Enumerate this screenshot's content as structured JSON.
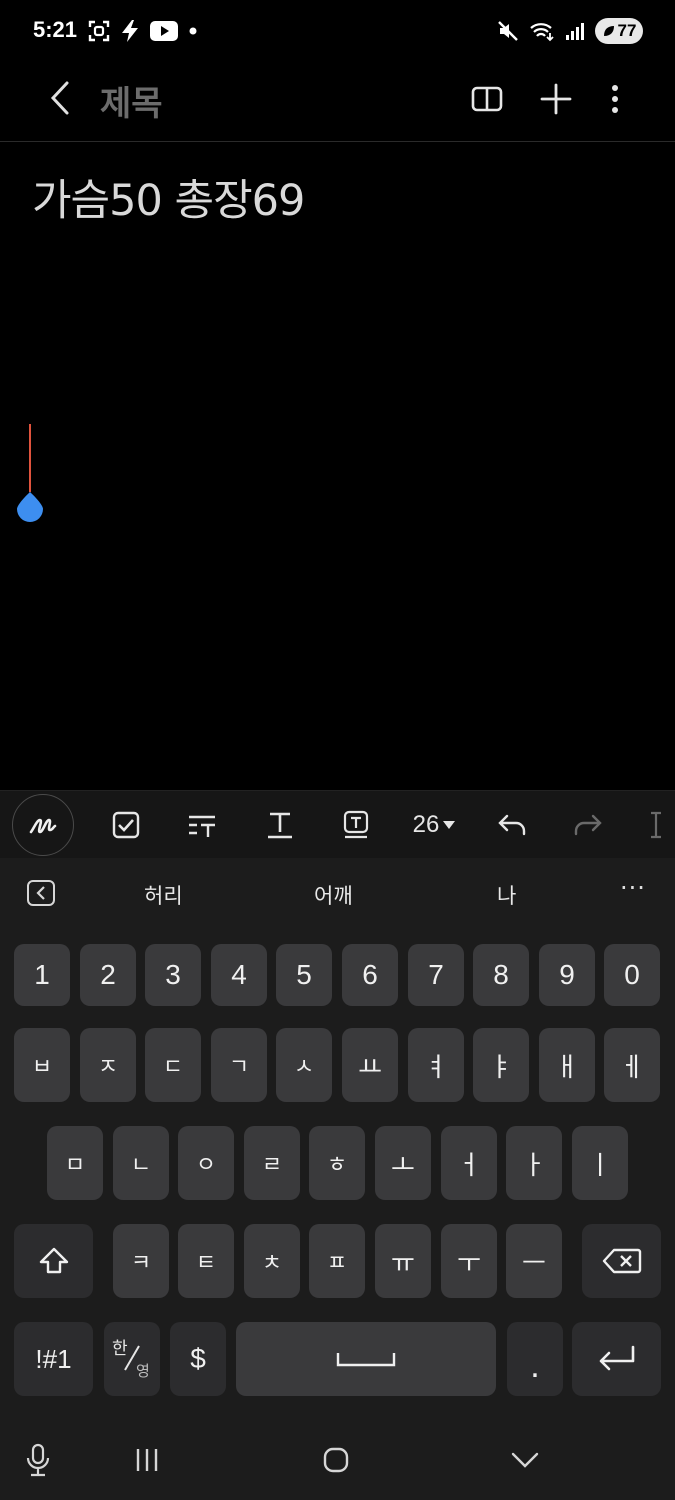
{
  "status_bar": {
    "time": "5:21",
    "battery_level": "77",
    "left_icons": [
      "screenshot-icon",
      "flash-icon",
      "youtube-icon",
      "dot-icon"
    ],
    "right_icons": [
      "mute-icon",
      "wifi-icon",
      "signal-icon",
      "battery-icon"
    ]
  },
  "header": {
    "title": "제목"
  },
  "note": {
    "body_text": "가슴50 총장69"
  },
  "toolbar": {
    "font_size": "26"
  },
  "suggestions": {
    "items": [
      "허리",
      "어깨",
      "나"
    ],
    "more": "···"
  },
  "keyboard": {
    "row1": [
      "1",
      "2",
      "3",
      "4",
      "5",
      "6",
      "7",
      "8",
      "9",
      "0"
    ],
    "row2": [
      "ㅂ",
      "ㅈ",
      "ㄷ",
      "ㄱ",
      "ㅅ",
      "ㅛ",
      "ㅕ",
      "ㅑ",
      "ㅐ",
      "ㅔ"
    ],
    "row3": [
      "ㅁ",
      "ㄴ",
      "ㅇ",
      "ㄹ",
      "ㅎ",
      "ㅗ",
      "ㅓ",
      "ㅏ",
      "ㅣ"
    ],
    "row4": [
      "ㅋ",
      "ㅌ",
      "ㅊ",
      "ㅍ",
      "ㅠ",
      "ㅜ",
      "ㅡ"
    ],
    "symbols_label": "!#1",
    "lang_top": "한",
    "lang_bottom": "영",
    "dollar_label": "$",
    "period_label": "."
  },
  "colors": {
    "background": "#000000",
    "key": "#3a3a3c",
    "keyboard_bg": "#1c1c1c",
    "cursor": "#e0533d",
    "handle": "#3d8ef0",
    "title": "#6c6c6c"
  }
}
